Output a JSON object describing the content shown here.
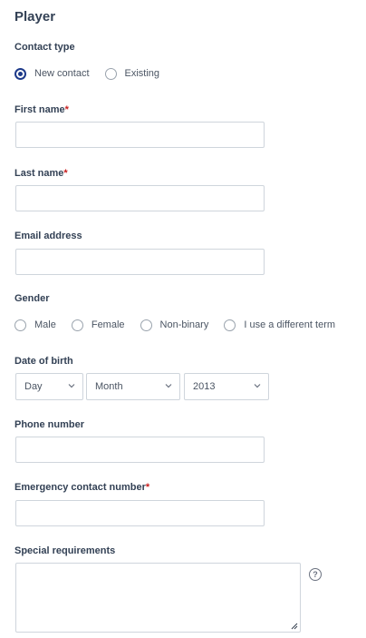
{
  "form": {
    "title": "Player",
    "contact_type": {
      "label": "Contact type",
      "options": [
        "New contact",
        "Existing"
      ],
      "selected": "New contact"
    },
    "first_name": {
      "label": "First name",
      "required_mark": "*",
      "value": ""
    },
    "last_name": {
      "label": "Last name",
      "required_mark": "*",
      "value": ""
    },
    "email": {
      "label": "Email address",
      "value": ""
    },
    "gender": {
      "label": "Gender",
      "options": [
        "Male",
        "Female",
        "Non-binary",
        "I use a different term"
      ],
      "selected": null
    },
    "dob": {
      "label": "Date of birth",
      "day": "Day",
      "month": "Month",
      "year": "2013"
    },
    "phone": {
      "label": "Phone number",
      "value": ""
    },
    "emergency": {
      "label": "Emergency contact number",
      "required_mark": "*",
      "value": ""
    },
    "special": {
      "label": "Special requirements",
      "value": ""
    },
    "help_glyph": "?"
  },
  "colors": {
    "accent": "#1d3a8a",
    "required": "#c81e1e",
    "border": "#cfd5dc"
  },
  "icons": {
    "select": "chevron-down-icon",
    "help": "question-circle-icon",
    "resize": "resize-grip-icon"
  }
}
